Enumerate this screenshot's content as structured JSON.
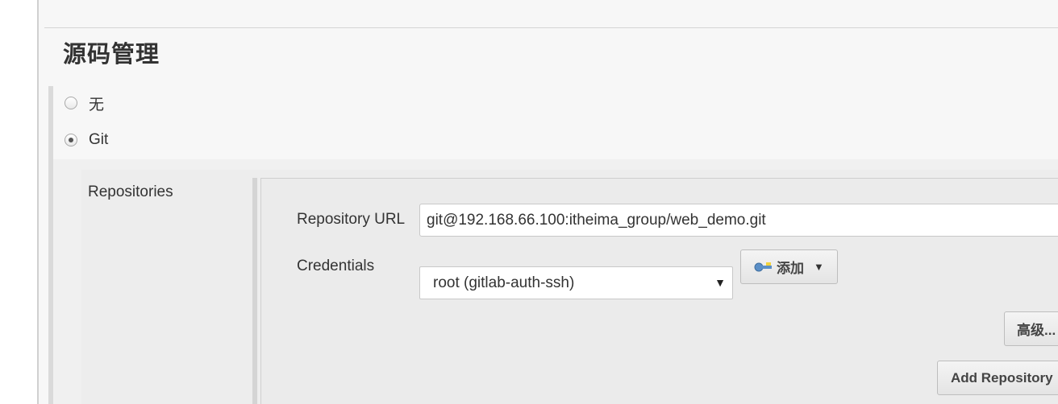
{
  "section": {
    "title": "源码管理"
  },
  "scm_options": [
    {
      "label": "无",
      "checked": false
    },
    {
      "label": "Git",
      "checked": true
    }
  ],
  "git": {
    "repositories_label": "Repositories",
    "repository_url_label": "Repository URL",
    "repository_url_value": "git@192.168.66.100:itheima_group/web_demo.git",
    "credentials_label": "Credentials",
    "credentials_selected": "root (gitlab-auth-ssh)",
    "add_button_label": "添加",
    "add_button_icon": "key-icon",
    "advanced_button_label": "高级...",
    "add_repository_button_label": "Add Repository"
  }
}
